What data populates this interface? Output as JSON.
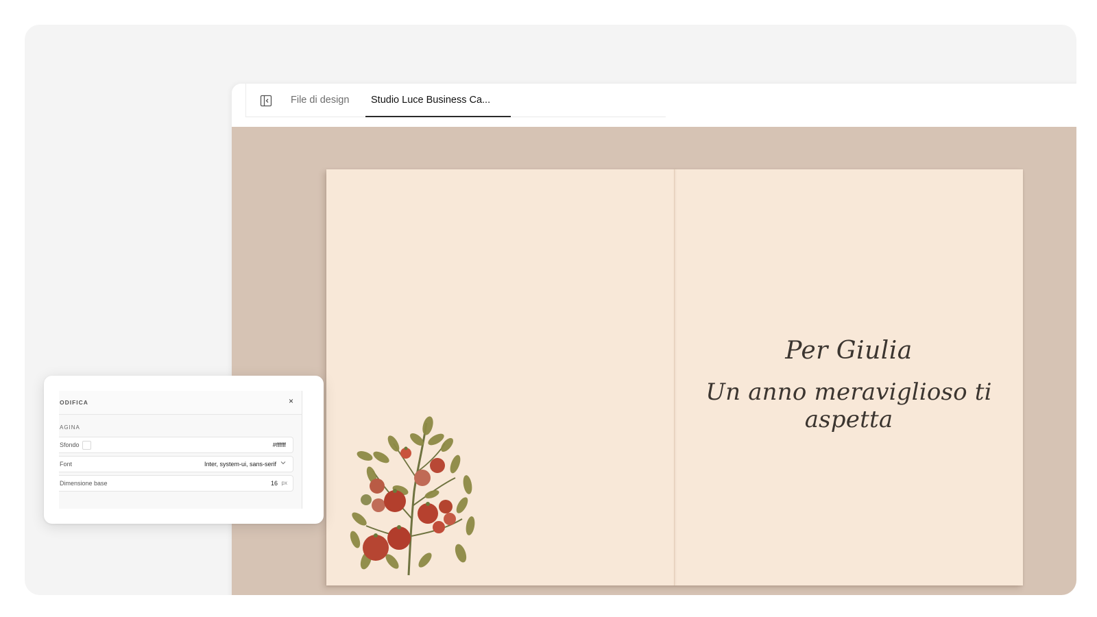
{
  "tabs": [
    {
      "label": "File di design",
      "active": false
    },
    {
      "label": "Studio Luce Business Ca...",
      "active": true
    }
  ],
  "card": {
    "name": "Per Giulia",
    "message": "Un anno meraviglioso ti aspetta",
    "colors": {
      "paper": "#f8e8d8",
      "canvas": "#d6c3b4",
      "text": "#3b3530"
    }
  },
  "edit_panel": {
    "title": "ODIFICA",
    "close": "×",
    "section": "AGINA",
    "rows": {
      "background": {
        "label": "Sfondo",
        "value": "#ffffff"
      },
      "font": {
        "label": "Font",
        "value": "Inter, system-ui, sans-serif"
      },
      "base_size": {
        "label": "Dimensione base",
        "value": "16",
        "unit": "px"
      }
    }
  },
  "icons": {
    "panel_toggle": "sidebar-toggle-icon",
    "font_dropdown": "chevron-down-icon",
    "illustration": "tomato-plant-illustration"
  }
}
